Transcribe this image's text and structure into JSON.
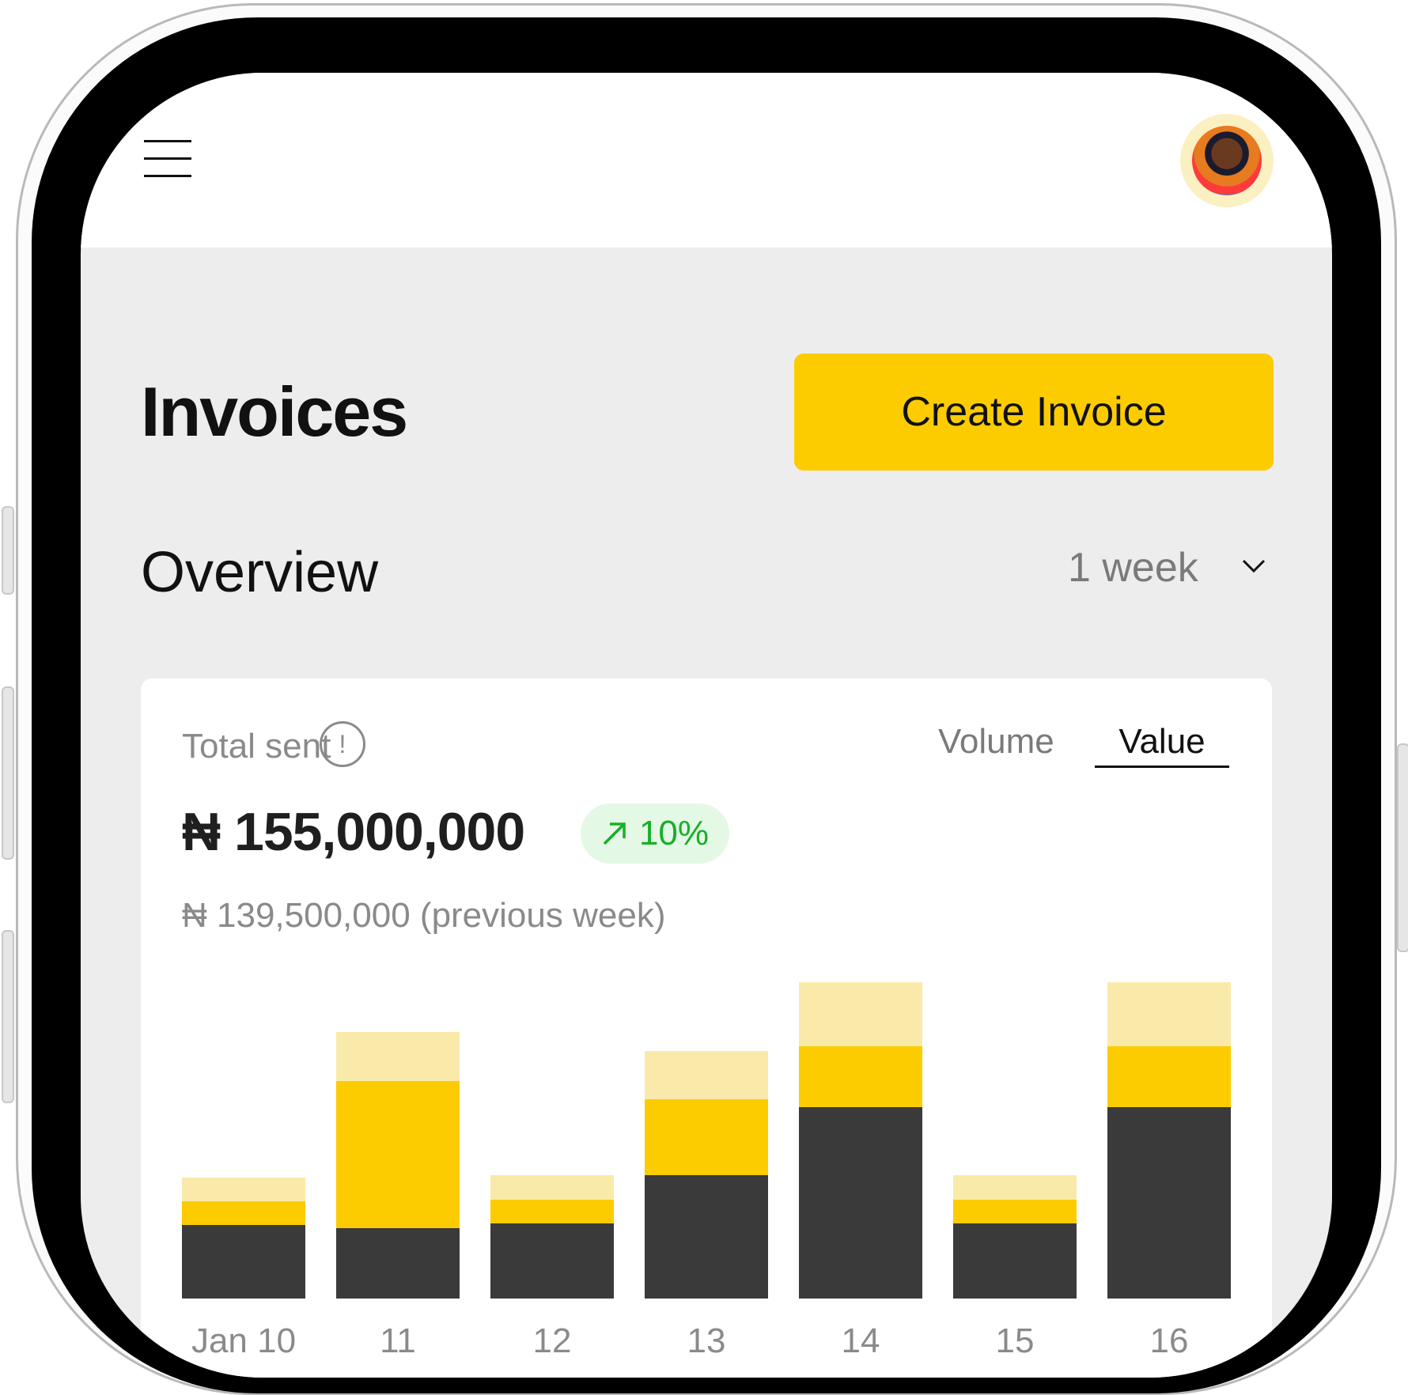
{
  "header": {
    "title": "Invoices",
    "create_button": "Create Invoice",
    "menu_icon": "hamburger-menu-icon",
    "avatar_icon": "user-avatar"
  },
  "overview": {
    "heading": "Overview",
    "range": "1 week"
  },
  "card": {
    "label": "Total sent",
    "info_icon": "!",
    "tabs": [
      "Volume",
      "Value"
    ],
    "active_tab": "Value",
    "amount": "₦ 155,000,000",
    "change": "10%",
    "change_icon": "arrow-up-right-icon",
    "previous": "₦ 139,500,000 (previous week)"
  },
  "colors": {
    "accent": "#fccc00",
    "light_accent": "#faeaaa",
    "dark": "#3a3a3a",
    "positive": "#17b026"
  },
  "chart_data": {
    "type": "bar",
    "stacked": true,
    "categories": [
      "Jan 10",
      "11",
      "12",
      "13",
      "14",
      "15",
      "16"
    ],
    "series": [
      {
        "values": [
          46,
          44,
          47,
          77,
          120,
          47,
          120
        ]
      },
      {
        "values": [
          15,
          92,
          15,
          48,
          38,
          15,
          38
        ]
      },
      {
        "values": [
          15,
          31,
          15,
          30,
          40,
          15,
          40
        ]
      }
    ],
    "ylim": [
      0,
      200
    ]
  }
}
